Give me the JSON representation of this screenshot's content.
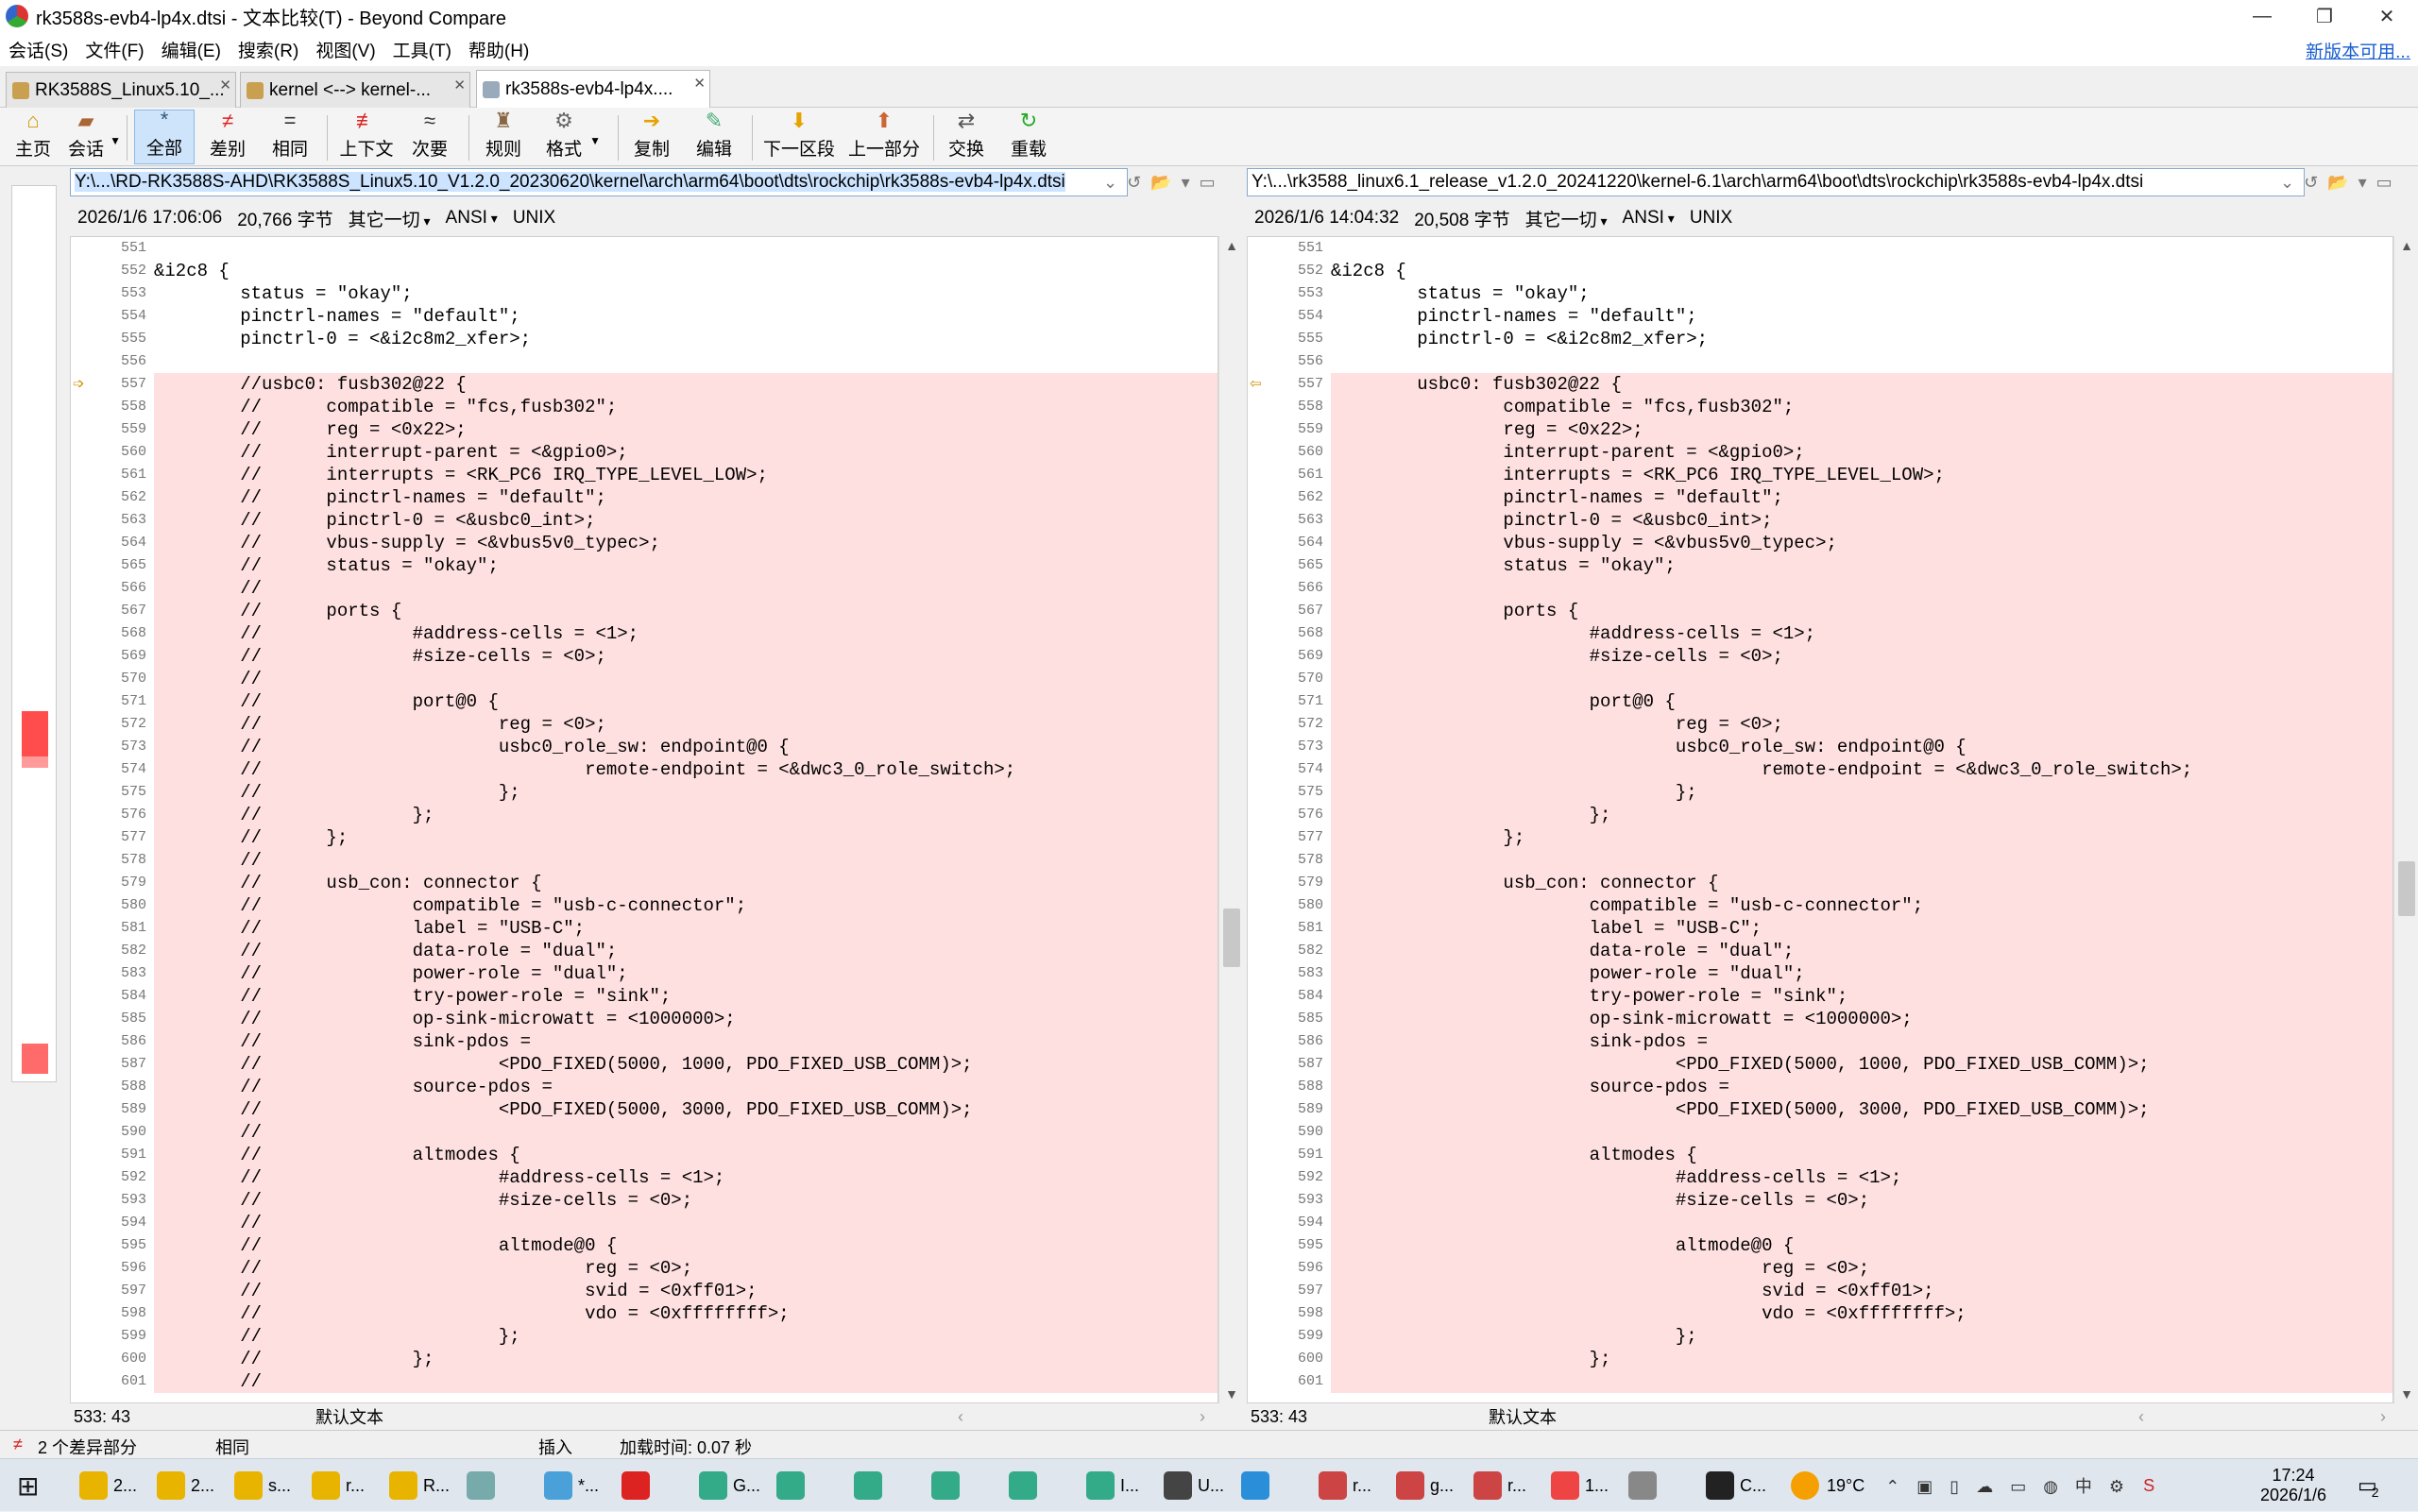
{
  "window": {
    "title": "rk3588s-evb4-lp4x.dtsi - 文本比较(T) - Beyond Compare",
    "min": "—",
    "max": "❐",
    "close": "✕"
  },
  "menu": {
    "items": [
      "会话(S)",
      "文件(F)",
      "编辑(E)",
      "搜索(R)",
      "视图(V)",
      "工具(T)",
      "帮助(H)"
    ],
    "new_version": "新版本可用..."
  },
  "tabs": [
    {
      "label": "RK3588S_Linux5.10_..."
    },
    {
      "label": "kernel <--> kernel-..."
    },
    {
      "label": "rk3588s-evb4-lp4x...."
    }
  ],
  "toolbar": {
    "home": "主页",
    "session": "会话",
    "all": "全部",
    "diffs": "差别",
    "same": "相同",
    "context": "上下文",
    "minor": "次要",
    "rules": "规则",
    "format": "格式",
    "copy": "复制",
    "edit": "编辑",
    "next_section": "下一区段",
    "prev_section": "上一部分",
    "swap": "交换",
    "reload": "重载"
  },
  "left": {
    "path": "Y:\\...\\RD-RK3588S-AHD\\RK3588S_Linux5.10_V1.2.0_20230620\\kernel\\arch\\arm64\\boot\\dts\\rockchip\\rk3588s-evb4-lp4x.dtsi",
    "datetime": "2026/1/6 17:06:06",
    "size": "20,766 字节",
    "other": "其它一切",
    "encoding": "ANSI",
    "lineend": "UNIX",
    "cursor": "533: 43",
    "mode": "默认文本"
  },
  "right": {
    "path": "Y:\\...\\rk3588_linux6.1_release_v1.2.0_20241220\\kernel-6.1\\arch\\arm64\\boot\\dts\\rockchip\\rk3588s-evb4-lp4x.dtsi",
    "datetime": "2026/1/6 14:04:32",
    "size": "20,508 字节",
    "other": "其它一切",
    "encoding": "ANSI",
    "lineend": "UNIX",
    "cursor": "533: 43",
    "mode": "默认文本"
  },
  "lines": [
    {
      "n": "551",
      "l": "",
      "r": "",
      "d": false
    },
    {
      "n": "552",
      "l": "&i2c8 {",
      "r": "&i2c8 {",
      "d": false
    },
    {
      "n": "553",
      "l": "        status = \"okay\";",
      "r": "        status = \"okay\";",
      "d": false
    },
    {
      "n": "554",
      "l": "        pinctrl-names = \"default\";",
      "r": "        pinctrl-names = \"default\";",
      "d": false
    },
    {
      "n": "555",
      "l": "        pinctrl-0 = <&i2c8m2_xfer>;",
      "r": "        pinctrl-0 = <&i2c8m2_xfer>;",
      "d": false
    },
    {
      "n": "556",
      "l": "",
      "r": "",
      "d": false
    },
    {
      "n": "557",
      "l": "        //usbc0: fusb302@22 {",
      "r": "        usbc0: fusb302@22 {",
      "d": true
    },
    {
      "n": "558",
      "l": "        //      compatible = \"fcs,fusb302\";",
      "r": "                compatible = \"fcs,fusb302\";",
      "d": true
    },
    {
      "n": "559",
      "l": "        //      reg = <0x22>;",
      "r": "                reg = <0x22>;",
      "d": true
    },
    {
      "n": "560",
      "l": "        //      interrupt-parent = <&gpio0>;",
      "r": "                interrupt-parent = <&gpio0>;",
      "d": true
    },
    {
      "n": "561",
      "l": "        //      interrupts = <RK_PC6 IRQ_TYPE_LEVEL_LOW>;",
      "r": "                interrupts = <RK_PC6 IRQ_TYPE_LEVEL_LOW>;",
      "d": true
    },
    {
      "n": "562",
      "l": "        //      pinctrl-names = \"default\";",
      "r": "                pinctrl-names = \"default\";",
      "d": true
    },
    {
      "n": "563",
      "l": "        //      pinctrl-0 = <&usbc0_int>;",
      "r": "                pinctrl-0 = <&usbc0_int>;",
      "d": true
    },
    {
      "n": "564",
      "l": "        //      vbus-supply = <&vbus5v0_typec>;",
      "r": "                vbus-supply = <&vbus5v0_typec>;",
      "d": true
    },
    {
      "n": "565",
      "l": "        //      status = \"okay\";",
      "r": "                status = \"okay\";",
      "d": true
    },
    {
      "n": "566",
      "l": "        //",
      "r": "",
      "d": true
    },
    {
      "n": "567",
      "l": "        //      ports {",
      "r": "                ports {",
      "d": true
    },
    {
      "n": "568",
      "l": "        //              #address-cells = <1>;",
      "r": "                        #address-cells = <1>;",
      "d": true
    },
    {
      "n": "569",
      "l": "        //              #size-cells = <0>;",
      "r": "                        #size-cells = <0>;",
      "d": true
    },
    {
      "n": "570",
      "l": "        //",
      "r": "",
      "d": true
    },
    {
      "n": "571",
      "l": "        //              port@0 {",
      "r": "                        port@0 {",
      "d": true
    },
    {
      "n": "572",
      "l": "        //                      reg = <0>;",
      "r": "                                reg = <0>;",
      "d": true
    },
    {
      "n": "573",
      "l": "        //                      usbc0_role_sw: endpoint@0 {",
      "r": "                                usbc0_role_sw: endpoint@0 {",
      "d": true
    },
    {
      "n": "574",
      "l": "        //                              remote-endpoint = <&dwc3_0_role_switch>;",
      "r": "                                        remote-endpoint = <&dwc3_0_role_switch>;",
      "d": true
    },
    {
      "n": "575",
      "l": "        //                      };",
      "r": "                                };",
      "d": true
    },
    {
      "n": "576",
      "l": "        //              };",
      "r": "                        };",
      "d": true
    },
    {
      "n": "577",
      "l": "        //      };",
      "r": "                };",
      "d": true
    },
    {
      "n": "578",
      "l": "        //",
      "r": "",
      "d": true
    },
    {
      "n": "579",
      "l": "        //      usb_con: connector {",
      "r": "                usb_con: connector {",
      "d": true
    },
    {
      "n": "580",
      "l": "        //              compatible = \"usb-c-connector\";",
      "r": "                        compatible = \"usb-c-connector\";",
      "d": true
    },
    {
      "n": "581",
      "l": "        //              label = \"USB-C\";",
      "r": "                        label = \"USB-C\";",
      "d": true
    },
    {
      "n": "582",
      "l": "        //              data-role = \"dual\";",
      "r": "                        data-role = \"dual\";",
      "d": true
    },
    {
      "n": "583",
      "l": "        //              power-role = \"dual\";",
      "r": "                        power-role = \"dual\";",
      "d": true
    },
    {
      "n": "584",
      "l": "        //              try-power-role = \"sink\";",
      "r": "                        try-power-role = \"sink\";",
      "d": true
    },
    {
      "n": "585",
      "l": "        //              op-sink-microwatt = <1000000>;",
      "r": "                        op-sink-microwatt = <1000000>;",
      "d": true
    },
    {
      "n": "586",
      "l": "        //              sink-pdos =",
      "r": "                        sink-pdos =",
      "d": true
    },
    {
      "n": "587",
      "l": "        //                      <PDO_FIXED(5000, 1000, PDO_FIXED_USB_COMM)>;",
      "r": "                                <PDO_FIXED(5000, 1000, PDO_FIXED_USB_COMM)>;",
      "d": true
    },
    {
      "n": "588",
      "l": "        //              source-pdos =",
      "r": "                        source-pdos =",
      "d": true
    },
    {
      "n": "589",
      "l": "        //                      <PDO_FIXED(5000, 3000, PDO_FIXED_USB_COMM)>;",
      "r": "                                <PDO_FIXED(5000, 3000, PDO_FIXED_USB_COMM)>;",
      "d": true
    },
    {
      "n": "590",
      "l": "        //",
      "r": "",
      "d": true
    },
    {
      "n": "591",
      "l": "        //              altmodes {",
      "r": "                        altmodes {",
      "d": true
    },
    {
      "n": "592",
      "l": "        //                      #address-cells = <1>;",
      "r": "                                #address-cells = <1>;",
      "d": true
    },
    {
      "n": "593",
      "l": "        //                      #size-cells = <0>;",
      "r": "                                #size-cells = <0>;",
      "d": true
    },
    {
      "n": "594",
      "l": "        //",
      "r": "",
      "d": true
    },
    {
      "n": "595",
      "l": "        //                      altmode@0 {",
      "r": "                                altmode@0 {",
      "d": true
    },
    {
      "n": "596",
      "l": "        //                              reg = <0>;",
      "r": "                                        reg = <0>;",
      "d": true
    },
    {
      "n": "597",
      "l": "        //                              svid = <0xff01>;",
      "r": "                                        svid = <0xff01>;",
      "d": true
    },
    {
      "n": "598",
      "l": "        //                              vdo = <0xffffffff>;",
      "r": "                                        vdo = <0xffffffff>;",
      "d": true
    },
    {
      "n": "599",
      "l": "        //                      };",
      "r": "                                };",
      "d": true
    },
    {
      "n": "600",
      "l": "        //              };",
      "r": "                        };",
      "d": true
    },
    {
      "n": "601",
      "l": "        //",
      "r": "",
      "d": true
    }
  ],
  "status": {
    "diffs": "2 个差异部分",
    "same": "相同",
    "insert": "插入",
    "loadtime": "加载时间: 0.07 秒"
  },
  "taskbar": {
    "items": [
      "2...",
      "2...",
      "s...",
      "r...",
      "R...",
      "",
      "*...",
      "",
      "G...",
      "",
      "",
      "",
      "",
      "I...",
      "U...",
      "",
      "r...",
      "g...",
      "r...",
      "1...",
      "",
      "C..."
    ],
    "weather": "19°C",
    "time": "17:24",
    "date": "2026/1/6",
    "notif": "2"
  }
}
